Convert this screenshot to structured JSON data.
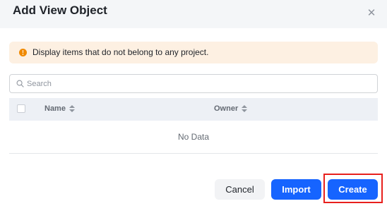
{
  "dialog": {
    "title": "Add View Object",
    "close_icon": "close-icon"
  },
  "alert": {
    "icon": "warning-icon",
    "color": "#f08a00",
    "text": "Display items that do not belong to any project."
  },
  "search": {
    "placeholder": "Search",
    "value": ""
  },
  "table": {
    "columns": [
      {
        "label": "Name",
        "sortable": true
      },
      {
        "label": "Owner",
        "sortable": true
      }
    ],
    "empty_text": "No Data"
  },
  "footer": {
    "cancel_label": "Cancel",
    "import_label": "Import",
    "create_label": "Create",
    "primary_color": "#1664ff",
    "highlight_color": "#e8201d"
  }
}
